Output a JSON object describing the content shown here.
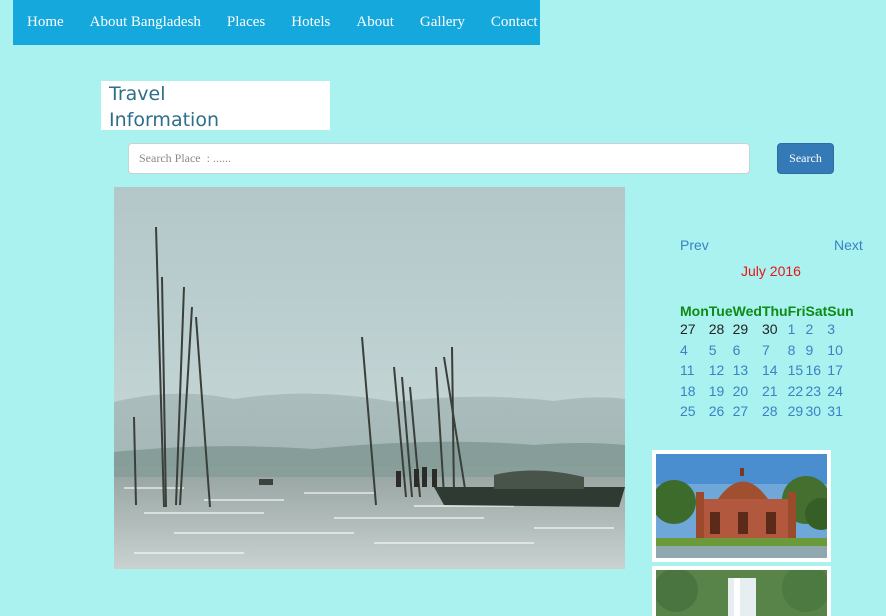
{
  "nav": {
    "items": [
      "Home",
      "About Bangladesh",
      "Places",
      "Hotels",
      "About",
      "Gallery",
      "Contact"
    ]
  },
  "logo": {
    "line1": "Travel",
    "line2": "Information"
  },
  "search": {
    "placeholder": "Search Place  : ......",
    "button_label": "Search"
  },
  "calendar": {
    "prev_label": "Prev",
    "next_label": "Next",
    "month_label": "July 2016",
    "weekdays": [
      "Mon",
      "Tue",
      "Wed",
      "Thu",
      "Fri",
      "Sat",
      "Sun"
    ],
    "weeks": [
      [
        "27",
        "28",
        "29",
        "30",
        "1",
        "2",
        "3"
      ],
      [
        "4",
        "5",
        "6",
        "7",
        "8",
        "9",
        "10"
      ],
      [
        "11",
        "12",
        "13",
        "14",
        "15",
        "16",
        "17"
      ],
      [
        "18",
        "19",
        "20",
        "21",
        "22",
        "23",
        "24"
      ],
      [
        "25",
        "26",
        "27",
        "28",
        "29",
        "30",
        "31"
      ]
    ]
  },
  "colors": {
    "page_background": "#aaf2ef",
    "nav_background": "#14a8dd",
    "search_button": "#337ab7",
    "month_label": "#e8141a",
    "weekday_header": "#0e8a17",
    "link": "#3a82c4"
  }
}
